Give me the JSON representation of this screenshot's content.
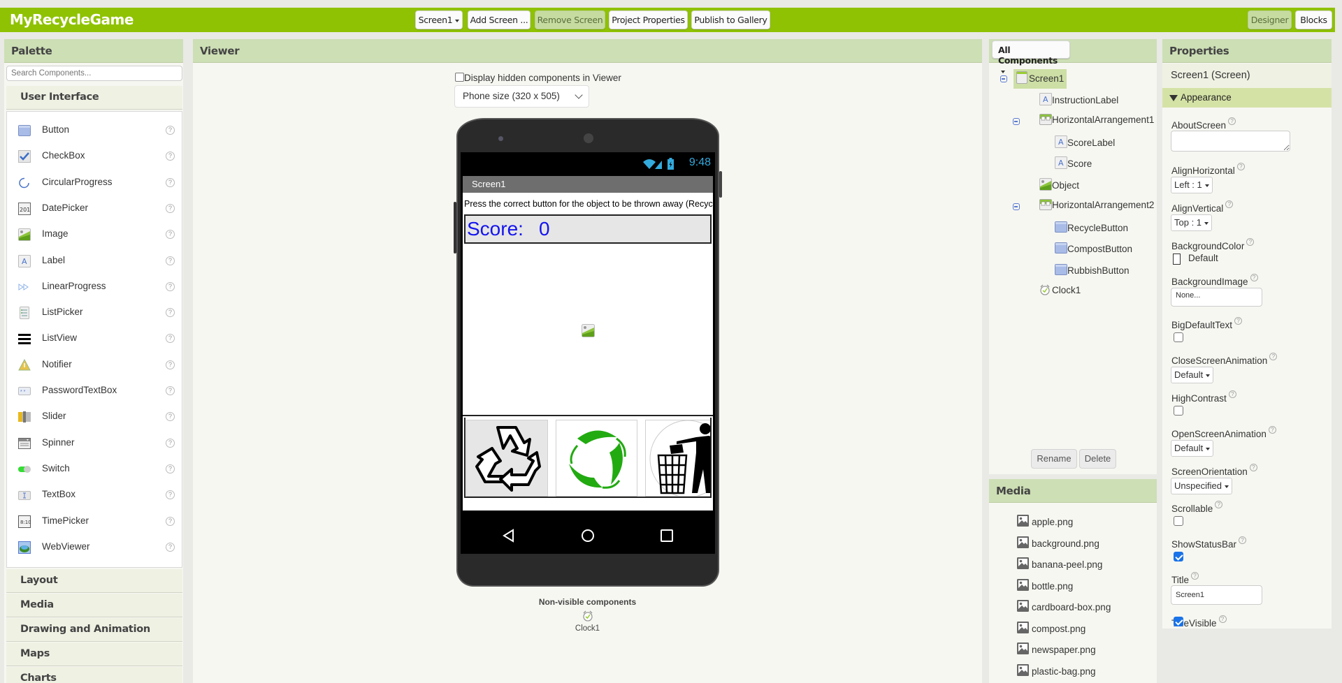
{
  "app": {
    "title": "MyRecycleGame"
  },
  "toolbar": {
    "screen_select": "Screen1",
    "add_screen": "Add Screen ...",
    "remove_screen": "Remove Screen",
    "project_properties": "Project Properties",
    "publish": "Publish to Gallery",
    "designer": "Designer",
    "blocks": "Blocks"
  },
  "palette": {
    "title": "Palette",
    "search_placeholder": "Search Components...",
    "open_category": "User Interface",
    "items": [
      {
        "label": "Button",
        "icon": "button-icon"
      },
      {
        "label": "CheckBox",
        "icon": "checkbox-icon"
      },
      {
        "label": "CircularProgress",
        "icon": "circular-progress-icon"
      },
      {
        "label": "DatePicker",
        "icon": "datepicker-icon"
      },
      {
        "label": "Image",
        "icon": "image-icon"
      },
      {
        "label": "Label",
        "icon": "label-icon"
      },
      {
        "label": "LinearProgress",
        "icon": "linear-progress-icon"
      },
      {
        "label": "ListPicker",
        "icon": "listpicker-icon"
      },
      {
        "label": "ListView",
        "icon": "listview-icon"
      },
      {
        "label": "Notifier",
        "icon": "notifier-icon"
      },
      {
        "label": "PasswordTextBox",
        "icon": "password-textbox-icon"
      },
      {
        "label": "Slider",
        "icon": "slider-icon"
      },
      {
        "label": "Spinner",
        "icon": "spinner-icon"
      },
      {
        "label": "Switch",
        "icon": "switch-icon"
      },
      {
        "label": "TextBox",
        "icon": "textbox-icon"
      },
      {
        "label": "TimePicker",
        "icon": "timepicker-icon"
      },
      {
        "label": "WebViewer",
        "icon": "webviewer-icon"
      }
    ],
    "help_glyph": "?",
    "categories": [
      "Layout",
      "Media",
      "Drawing and Animation",
      "Maps",
      "Charts"
    ]
  },
  "viewer": {
    "title": "Viewer",
    "hidden_checkbox_label": "Display hidden components in Viewer",
    "hidden_checked": false,
    "phone_size": "Phone size (320 x 505)",
    "phone": {
      "time": "9:48",
      "screen_title": "Screen1",
      "instruction": "Press the correct button for the object to be thrown away (Recycle",
      "score_label": "Score:",
      "score_value": "0"
    },
    "nonvisible_title": "Non-visible components",
    "nonvisible_items": [
      "Clock1"
    ]
  },
  "components": {
    "dropdown": "All Components",
    "tree": [
      {
        "label": "Screen1",
        "icon": "screen-icon",
        "level": 0,
        "toggle": true,
        "selected": true
      },
      {
        "label": "InstructionLabel",
        "icon": "label-icon",
        "level": 1,
        "toggle": false
      },
      {
        "label": "HorizontalArrangement1",
        "icon": "horizontal-arrangement-icon",
        "level": 1,
        "toggle": true
      },
      {
        "label": "ScoreLabel",
        "icon": "label-icon",
        "level": 2,
        "toggle": false
      },
      {
        "label": "Score",
        "icon": "label-icon",
        "level": 2,
        "toggle": false
      },
      {
        "label": "Object",
        "icon": "image-icon",
        "level": 1,
        "toggle": false
      },
      {
        "label": "HorizontalArrangement2",
        "icon": "horizontal-arrangement-icon",
        "level": 1,
        "toggle": true
      },
      {
        "label": "RecycleButton",
        "icon": "button-icon",
        "level": 2,
        "toggle": false
      },
      {
        "label": "CompostButton",
        "icon": "button-icon",
        "level": 2,
        "toggle": false
      },
      {
        "label": "RubbishButton",
        "icon": "button-icon",
        "level": 2,
        "toggle": false
      },
      {
        "label": "Clock1",
        "icon": "clock-icon",
        "level": 1,
        "toggle": false
      }
    ],
    "rename": "Rename",
    "delete": "Delete"
  },
  "media": {
    "title": "Media",
    "files": [
      "apple.png",
      "background.png",
      "banana-peel.png",
      "bottle.png",
      "cardboard-box.png",
      "compost.png",
      "newspaper.png",
      "plastic-bag.png"
    ]
  },
  "properties": {
    "title": "Properties",
    "subject": "Screen1 (Screen)",
    "group": "Appearance",
    "AboutScreen": {
      "label": "AboutScreen",
      "value": ""
    },
    "AlignHorizontal": {
      "label": "AlignHorizontal",
      "value": "Left : 1"
    },
    "AlignVertical": {
      "label": "AlignVertical",
      "value": "Top : 1"
    },
    "BackgroundColor": {
      "label": "BackgroundColor",
      "value": "Default"
    },
    "BackgroundImage": {
      "label": "BackgroundImage",
      "value": "None..."
    },
    "BigDefaultText": {
      "label": "BigDefaultText",
      "checked": false
    },
    "CloseScreenAnimation": {
      "label": "CloseScreenAnimation",
      "value": "Default"
    },
    "HighContrast": {
      "label": "HighContrast",
      "checked": false
    },
    "OpenScreenAnimation": {
      "label": "OpenScreenAnimation",
      "value": "Default"
    },
    "ScreenOrientation": {
      "label": "ScreenOrientation",
      "value": "Unspecified"
    },
    "Scrollable": {
      "label": "Scrollable",
      "checked": false
    },
    "ShowStatusBar": {
      "label": "ShowStatusBar",
      "checked": true
    },
    "Title": {
      "label": "Title",
      "value": "Screen1"
    },
    "TitleVisible": {
      "label": "TitleVisible",
      "checked": true
    }
  },
  "colors": {
    "brand_green": "#8fc202",
    "panel_header": "#cddfb5",
    "score_text": "#1515ef",
    "compost_green": "#22aa11"
  }
}
